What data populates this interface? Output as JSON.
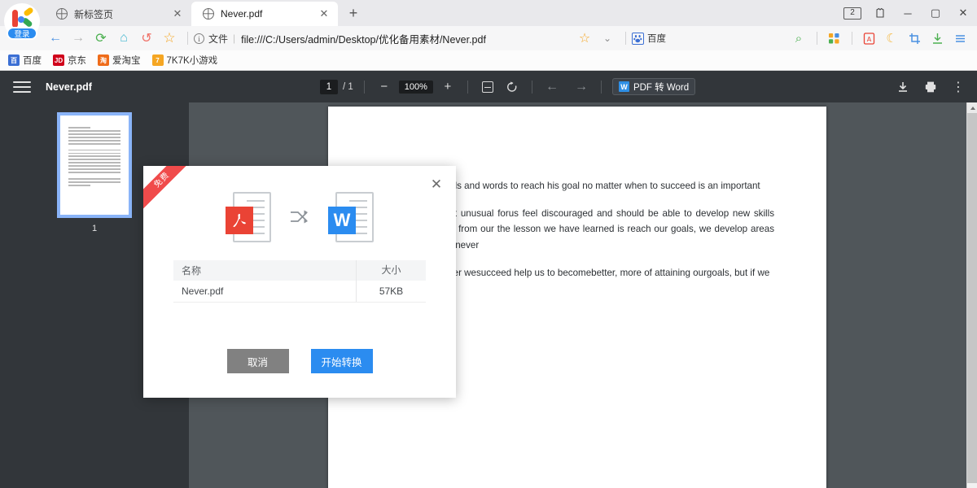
{
  "browser": {
    "logo_login_label": "登录",
    "tabs": [
      {
        "title": "新标签页",
        "active": false,
        "close_label": "✕"
      },
      {
        "title": "Never.pdf",
        "active": true,
        "close_label": "✕"
      }
    ],
    "new_tab_label": "+",
    "window": {
      "tab_count": "2",
      "minimize": "─",
      "maximize": "▢",
      "close": "✕",
      "skin_icon": "♕"
    },
    "nav": {
      "back": "←",
      "forward": "→",
      "reload": "⟳",
      "home": "⌂",
      "history": "↺",
      "favorite": "☆"
    },
    "address": {
      "info_icon": "i",
      "file_label": "文件",
      "divider": "|",
      "url": "file:///C:/Users/admin/Desktop/优化备用素材/Never.pdf"
    },
    "toolbar_right": {
      "star": "☆",
      "chevron": "⌄",
      "baidu_label": "百度",
      "baidu_mark": "熊",
      "search": "⌕",
      "apps": "▦",
      "pdf_tool": "A",
      "night_mode": "☾",
      "screenshot": "⛶",
      "downloads": "⇓",
      "menu": "☰"
    },
    "bookmarks": [
      {
        "label": "百度",
        "mark": "百",
        "color": "#3b6fd4"
      },
      {
        "label": "京东",
        "mark": "JD",
        "color": "#d0021b"
      },
      {
        "label": "爱淘宝",
        "mark": "淘",
        "color": "#ef6c1a"
      },
      {
        "label": "7K7K小游戏",
        "mark": "7",
        "color": "#f5a623"
      }
    ]
  },
  "pdf_viewer": {
    "menu_icon": "hamburger-icon",
    "file_name": "Never.pdf",
    "page_current": "1",
    "page_total": "/ 1",
    "zoom_out": "−",
    "zoom_level": "100%",
    "zoom_in": "+",
    "fit_page": "fit-page-icon",
    "rotate": "↺",
    "prev_page": "←",
    "next_page": "→",
    "pdf_to_word_label": "PDF 转 Word",
    "pdf_to_word_mark": "W",
    "download": "⤓",
    "print": "🖶",
    "more": "⋮",
    "thumbnail_page_label": "1"
  },
  "document": {
    "paragraphs": [
      "encouraging words and words to reach his goal no matter when to succeed is an important",
      "anything. It is not unusual forus feel discouraged and should be able to develop new skills that we can learn from our the lesson we have learned is reach our goals, we develop areas of our lives. If we never",
      "our goals. Whether wesucceed help us to becomebetter, more of attaining ourgoals, but if we"
    ]
  },
  "modal": {
    "ribbon_label": "免费",
    "close_label": "✕",
    "source_format": "PDF",
    "source_mark": "人",
    "convert_icon": "⤫",
    "target_format": "Word",
    "target_mark": "W",
    "table": {
      "headers": [
        "名称",
        "大小"
      ],
      "rows": [
        {
          "name": "Never.pdf",
          "size": "57KB"
        }
      ]
    },
    "cancel_label": "取消",
    "confirm_label": "开始转换"
  },
  "colors": {
    "accent_blue": "#2b8cf0",
    "ribbon_red": "#f04b4b",
    "pdf_red": "#ea4335",
    "toolbar_dark": "#32363a",
    "viewer_bg": "#50565a"
  }
}
